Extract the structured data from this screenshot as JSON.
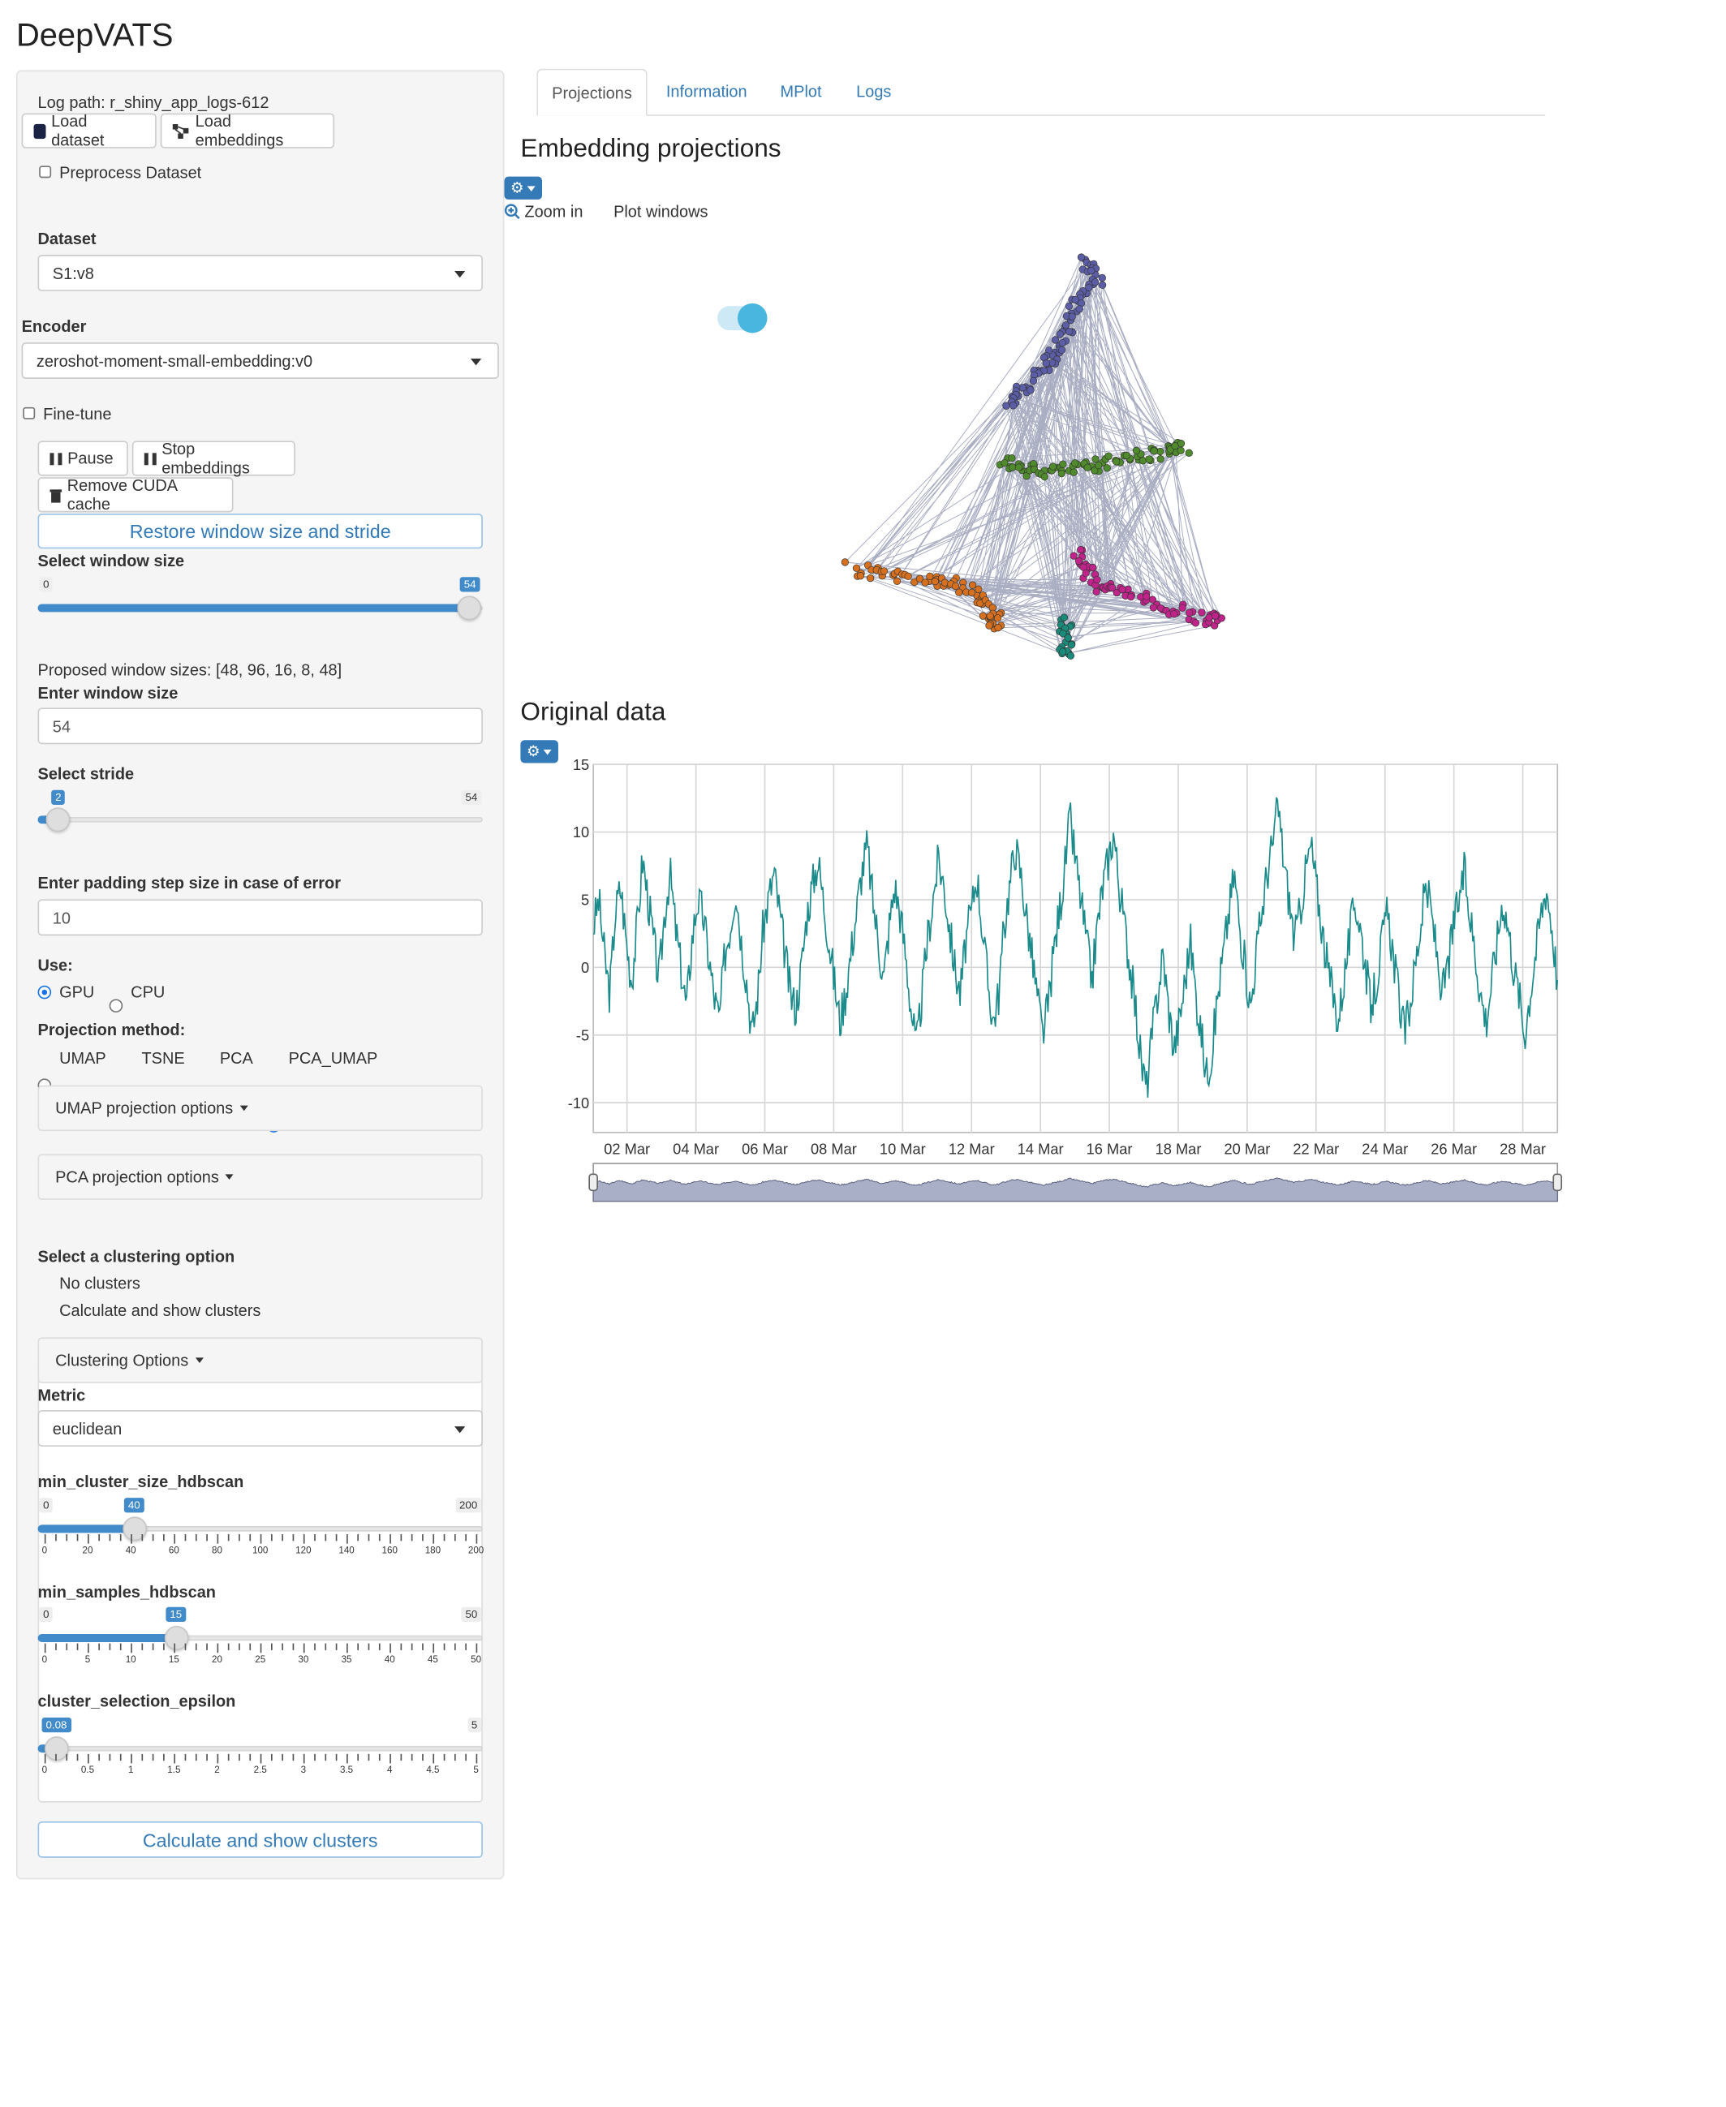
{
  "app": {
    "title": "DeepVATS"
  },
  "sidebar": {
    "log_path": "Log path: r_shiny_app_logs-612",
    "load_dataset": "Load dataset",
    "load_embeddings": "Load embeddings",
    "preprocess_label": "Preprocess Dataset",
    "dataset_label": "Dataset",
    "dataset_value": "S1:v8",
    "encoder_label": "Encoder",
    "encoder_value": "zeroshot-moment-small-embedding:v0",
    "finetune_label": "Fine-tune",
    "pause": "Pause",
    "stop_embeddings": "Stop embeddings",
    "remove_cuda": "Remove CUDA cache",
    "restore_button": "Restore window size and stride",
    "window_size": {
      "label": "Select window size",
      "min": "0",
      "max": "54",
      "value": "54",
      "fraction": 1.0
    },
    "proposed": "Proposed window sizes: [48, 96, 16, 8, 48]",
    "enter_window_label": "Enter window size",
    "enter_window_value": "54",
    "stride": {
      "label": "Select stride",
      "min": "0",
      "max": "54",
      "value": "2",
      "fraction": 0.037
    },
    "padding_label": "Enter padding step size in case of error",
    "padding_value": "10",
    "use_label": "Use:",
    "use_options": [
      "GPU",
      "CPU"
    ],
    "use_selected": "GPU",
    "projection_label": "Projection method:",
    "projection_options": [
      "UMAP",
      "TSNE",
      "PCA",
      "PCA_UMAP"
    ],
    "projection_selected": "PCA_UMAP",
    "umap_options": "UMAP projection options",
    "pca_options": "PCA projection options",
    "clustering_label": "Select a clustering option",
    "clustering_options": [
      "No clusters",
      "Calculate and show clusters"
    ],
    "clustering_selected": "Calculate and show clusters",
    "clustering_panel": "Clustering Options",
    "metric_label": "Metric",
    "metric_value": "euclidean",
    "min_cluster": {
      "label": "min_cluster_size_hdbscan",
      "min": "0",
      "max": "200",
      "value": "40",
      "fraction": 0.2,
      "ticks": [
        "0",
        "20",
        "40",
        "60",
        "80",
        "100",
        "120",
        "140",
        "160",
        "180",
        "200"
      ]
    },
    "min_samples": {
      "label": "min_samples_hdbscan",
      "min": "0",
      "max": "50",
      "value": "15",
      "fraction": 0.3,
      "ticks": [
        "0",
        "5",
        "10",
        "15",
        "20",
        "25",
        "30",
        "35",
        "40",
        "45",
        "50"
      ]
    },
    "epsilon": {
      "label": "cluster_selection_epsilon",
      "min": "0",
      "max": "5",
      "value": "0.08",
      "fraction": 0.016,
      "ticks": [
        "0",
        "0.5",
        "1",
        "1.5",
        "2",
        "2.5",
        "3",
        "3.5",
        "4",
        "4.5",
        "5"
      ]
    },
    "calc_button": "Calculate and show clusters"
  },
  "tabs": [
    "Projections",
    "Information",
    "MPlot",
    "Logs"
  ],
  "active_tab": "Projections",
  "main": {
    "embedding_title": "Embedding projections",
    "zoom_in": "Zoom in",
    "plot_windows": "Plot windows",
    "plot_windows_on": true,
    "original_title": "Original data"
  },
  "colors": {
    "accent": "#337ab7",
    "series": "#1a8a8a",
    "slider": "#428bca"
  },
  "chart_data": [
    {
      "type": "scatter",
      "clusters": [
        {
          "color": "#5b5ea6"
        },
        {
          "color": "#4f8a2c"
        },
        {
          "color": "#d6701f"
        },
        {
          "color": "#c0248a"
        },
        {
          "color": "#1a8a7a"
        }
      ],
      "connections_color": "#8e93ad"
    },
    {
      "type": "line",
      "x_ticks": [
        "02 Mar",
        "04 Mar",
        "06 Mar",
        "08 Mar",
        "10 Mar",
        "12 Mar",
        "14 Mar",
        "16 Mar",
        "18 Mar",
        "20 Mar",
        "22 Mar",
        "24 Mar",
        "26 Mar",
        "28 Mar"
      ],
      "y_ticks": [
        "15",
        "10",
        "5",
        "0",
        "-5",
        "-10"
      ],
      "ylim": [
        -12.2,
        15
      ],
      "grid": true,
      "range_selector": true,
      "series": [
        {
          "color": "#1a8a8a",
          "values": [
            3,
            5,
            1,
            -2,
            4,
            6,
            2,
            -1,
            3,
            8,
            5,
            2,
            -1,
            4,
            7,
            3,
            0,
            -3,
            2,
            5,
            4,
            1,
            -2,
            -4,
            1,
            3,
            6,
            2,
            -1,
            -5,
            -2,
            3,
            5,
            7,
            4,
            1,
            -2,
            -3,
            0,
            4,
            6,
            8,
            5,
            2,
            -1,
            -4,
            -2,
            1,
            4,
            7,
            9,
            5,
            2,
            -1,
            3,
            6,
            4,
            1,
            -3,
            -6,
            -2,
            2,
            5,
            8,
            6,
            3,
            0,
            -2,
            2,
            4,
            7,
            3,
            -1,
            -4,
            -2,
            3,
            6,
            9,
            7,
            4,
            1,
            -2,
            -5,
            -3,
            1,
            4,
            7,
            11,
            8,
            5,
            2,
            -1,
            3,
            6,
            8,
            10,
            6,
            3,
            0,
            -3,
            -7,
            -9,
            -5,
            -2,
            1,
            -3,
            -6,
            -4,
            -1,
            2,
            -2,
            -5,
            -8,
            -6,
            -2,
            1,
            4,
            7,
            3,
            0,
            -3,
            1,
            4,
            7,
            9,
            12,
            8,
            5,
            2,
            4,
            7,
            9,
            6,
            3,
            0,
            -2,
            -4,
            -1,
            2,
            5,
            3,
            0,
            -3,
            -1,
            2,
            4,
            1,
            -2,
            -5,
            -3,
            0,
            3,
            6,
            4,
            1,
            -2,
            0,
            3,
            5,
            7,
            4,
            1,
            -2,
            -4,
            -1,
            2,
            5,
            3,
            0,
            -2,
            -5,
            -2,
            1,
            4,
            6,
            3,
            -1
          ]
        }
      ]
    }
  ]
}
